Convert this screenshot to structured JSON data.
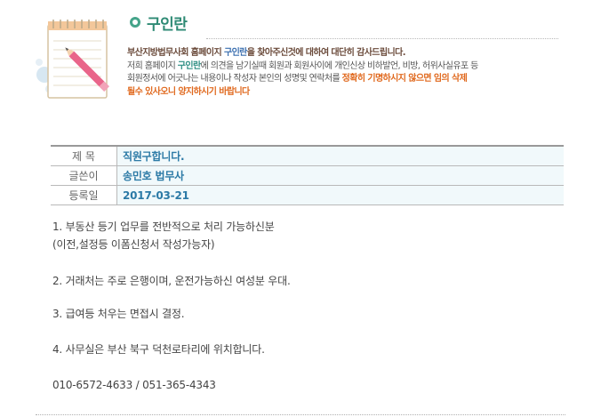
{
  "page": {
    "title": "구인란",
    "notice": {
      "line1": {
        "a": "부산지방법무사회 홈페이지 ",
        "b": "구인란",
        "c": "을 찾아주신것에 대하여 대단히 감사드립니다."
      },
      "line2": {
        "a": "저희 홈페이지 ",
        "b": "구인란",
        "c": "에 의견을 남기실때 회원과 회원사이에 개인신상 비하발언, 비방,  허위사실유포 등"
      },
      "line3": {
        "a": "회원정서에 어긋나는 내용이나 작성자 본인의 성명및 연락처를 ",
        "b": "정확히  기명하시지 않으면 임의 삭제"
      },
      "line4": "될수 있사오니 양지하시기 바랍니다"
    }
  },
  "post": {
    "labels": {
      "subject": "제 목",
      "author": "글쓴이",
      "date": "등록일"
    },
    "subject": "직원구합니다.",
    "author": "송민호 법무사",
    "date": "2017-03-21"
  },
  "content": {
    "lines": [
      "1. 부동산 등기 업무를 전반적으로 처리 가능하신분",
      "(이전,설정등 이폼신청서 작성가능자)",
      "2. 거래처는 주로 은행이며, 운전가능하신 여성분 우대.",
      "3. 급여등 처우는 면접시 결정.",
      "4. 사무실은 부산 북구 덕천로타리에 위치합니다.",
      "010-6572-4633 / 051-365-4343"
    ]
  },
  "icons": {
    "header_image": "notepad-pencil-icon",
    "title_bullet": "circle-bullet-icon"
  },
  "colors": {
    "title": "#2e8a74",
    "accent_blue": "#3b6fb0",
    "accent_orange": "#e0691e",
    "value_text": "#2c7aa6",
    "value_bg": "#f1f9fb"
  }
}
